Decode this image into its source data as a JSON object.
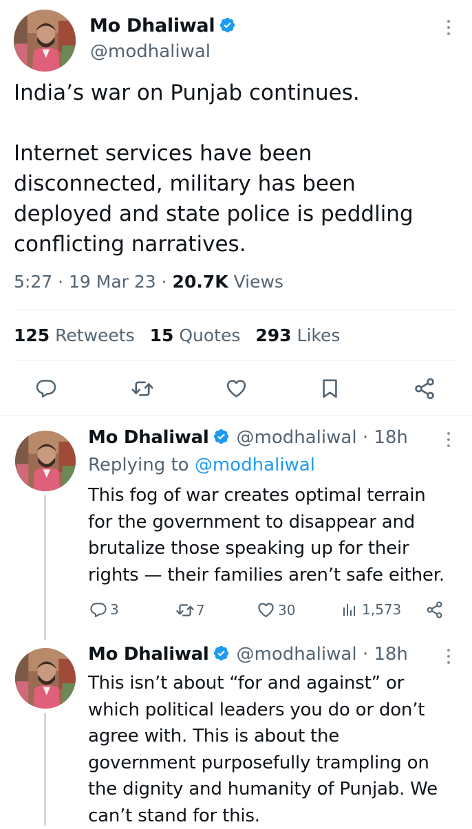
{
  "main_tweet": {
    "author_name": "Mo Dhaliwal",
    "handle": "@modhaliwal",
    "paragraph1": "India’s war on Punjab continues.",
    "paragraph2_lines": [
      "Internet services have been",
      "disconnected, military has been",
      "deployed and state police is peddling",
      "conflicting narratives."
    ],
    "time": "5:27",
    "date": "19 Mar 23",
    "sep": "·",
    "views_count": "20.7K",
    "views_label": "Views",
    "retweets_count": "125",
    "retweets_label": "Retweets",
    "quotes_count": "15",
    "quotes_label": "Quotes",
    "likes_count": "293",
    "likes_label": "Likes"
  },
  "replies": [
    {
      "author_name": "Mo Dhaliwal",
      "handle_time": "@modhaliwal · 18h",
      "replying_prefix": "Replying to ",
      "replying_to": "@modhaliwal",
      "lines": [
        "This fog of war creates optimal terrain",
        "for the government to disappear and",
        "brutalize those speaking up for their",
        "rights — their families aren’t safe either."
      ],
      "reply_count": "3",
      "retweet_count": "7",
      "like_count": "30",
      "view_count": "1,573"
    },
    {
      "author_name": "Mo Dhaliwal",
      "handle_time": "@modhaliwal · 18h",
      "lines": [
        "This isn’t about “for and against” or",
        "which political leaders you do or don’t",
        "agree with. This is about the",
        "government purposefully trampling on",
        "the dignity and humanity of Punjab. We",
        "can’t stand for this."
      ]
    }
  ],
  "icons": {
    "verified": "verified-badge-icon",
    "more": "more-vertical-icon",
    "reply": "reply-bubble-icon",
    "retweet": "retweet-icon",
    "like": "heart-icon",
    "bookmark": "bookmark-icon",
    "share": "share-icon",
    "views": "views-bar-chart-icon"
  },
  "colors": {
    "verified": "#1d9bf0",
    "link": "#1d9bf0",
    "text": "#0f1419",
    "secondary": "#536471",
    "divider": "#e7e9ea"
  }
}
